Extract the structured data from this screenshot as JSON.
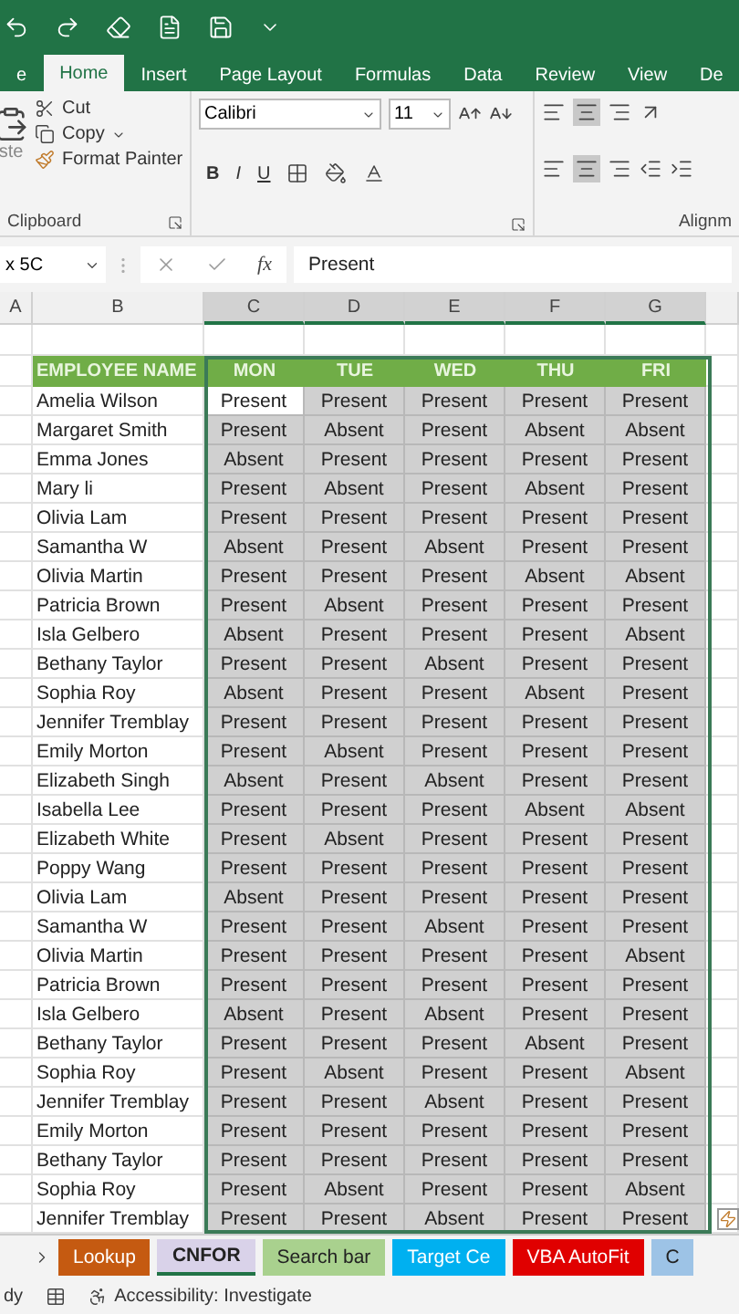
{
  "ribbon_tabs": [
    {
      "label": "e",
      "selected": false
    },
    {
      "label": "Home",
      "selected": true
    },
    {
      "label": "Insert",
      "selected": false
    },
    {
      "label": "Page Layout",
      "selected": false
    },
    {
      "label": "Formulas",
      "selected": false
    },
    {
      "label": "Data",
      "selected": false
    },
    {
      "label": "Review",
      "selected": false
    },
    {
      "label": "View",
      "selected": false
    },
    {
      "label": "De",
      "selected": false
    }
  ],
  "clipboard": {
    "paste": "ste",
    "cut": "Cut",
    "copy": "Copy",
    "format_painter": "Format Painter",
    "group_label": "Clipboard"
  },
  "font": {
    "name": "Calibri",
    "size": "11",
    "bold": "B",
    "italic": "I",
    "underline": "U"
  },
  "alignment": {
    "group_label": "Alignm"
  },
  "formula_bar": {
    "name_box": "x 5C",
    "fx": "fx",
    "value": "Present"
  },
  "column_headers": [
    {
      "label": "A",
      "selected": false
    },
    {
      "label": "B",
      "selected": false
    },
    {
      "label": "C",
      "selected": true
    },
    {
      "label": "D",
      "selected": true
    },
    {
      "label": "E",
      "selected": true
    },
    {
      "label": "F",
      "selected": true
    },
    {
      "label": "G",
      "selected": true
    }
  ],
  "table": {
    "columns": [
      "EMPLOYEE NAME",
      "MON",
      "TUE",
      "WED",
      "THU",
      "FRI"
    ],
    "rows": [
      {
        "active": true,
        "cells": [
          "Amelia Wilson",
          "Present",
          "Present",
          "Present",
          "Present",
          "Present"
        ]
      },
      {
        "active": false,
        "cells": [
          "Margaret Smith",
          "Present",
          "Absent",
          "Present",
          "Absent",
          "Absent"
        ]
      },
      {
        "active": false,
        "cells": [
          "Emma Jones",
          "Absent",
          "Present",
          "Present",
          "Present",
          "Present"
        ]
      },
      {
        "active": false,
        "cells": [
          "Mary li",
          "Present",
          "Absent",
          "Present",
          "Absent",
          "Present"
        ]
      },
      {
        "active": false,
        "cells": [
          "Olivia Lam",
          "Present",
          "Present",
          "Present",
          "Present",
          "Present"
        ]
      },
      {
        "active": false,
        "cells": [
          "Samantha W",
          "Absent",
          "Present",
          "Absent",
          "Present",
          "Present"
        ]
      },
      {
        "active": false,
        "cells": [
          "Olivia Martin",
          "Present",
          "Present",
          "Present",
          "Absent",
          "Absent"
        ]
      },
      {
        "active": false,
        "cells": [
          "Patricia Brown",
          "Present",
          "Absent",
          "Present",
          "Present",
          "Present"
        ]
      },
      {
        "active": false,
        "cells": [
          "Isla Gelbero",
          "Absent",
          "Present",
          "Present",
          "Present",
          "Absent"
        ]
      },
      {
        "active": false,
        "cells": [
          "Bethany Taylor",
          "Present",
          "Present",
          "Absent",
          "Present",
          "Present"
        ]
      },
      {
        "active": false,
        "cells": [
          "Sophia Roy",
          "Absent",
          "Present",
          "Present",
          "Absent",
          "Present"
        ]
      },
      {
        "active": false,
        "cells": [
          "Jennifer Tremblay",
          "Present",
          "Present",
          "Present",
          "Present",
          "Present"
        ]
      },
      {
        "active": false,
        "cells": [
          "Emily Morton",
          "Present",
          "Absent",
          "Present",
          "Present",
          "Present"
        ]
      },
      {
        "active": false,
        "cells": [
          "Elizabeth Singh",
          "Absent",
          "Present",
          "Absent",
          "Present",
          "Present"
        ]
      },
      {
        "active": false,
        "cells": [
          "Isabella Lee",
          "Present",
          "Present",
          "Present",
          "Absent",
          "Absent"
        ]
      },
      {
        "active": false,
        "cells": [
          "Elizabeth White",
          "Present",
          "Absent",
          "Present",
          "Present",
          "Present"
        ]
      },
      {
        "active": false,
        "cells": [
          "Poppy Wang",
          "Present",
          "Present",
          "Present",
          "Present",
          "Present"
        ]
      },
      {
        "active": false,
        "cells": [
          "Olivia Lam",
          "Absent",
          "Present",
          "Present",
          "Present",
          "Present"
        ]
      },
      {
        "active": false,
        "cells": [
          "Samantha W",
          "Present",
          "Present",
          "Absent",
          "Present",
          "Present"
        ]
      },
      {
        "active": false,
        "cells": [
          "Olivia Martin",
          "Present",
          "Present",
          "Present",
          "Present",
          "Absent"
        ]
      },
      {
        "active": false,
        "cells": [
          "Patricia Brown",
          "Present",
          "Present",
          "Present",
          "Present",
          "Present"
        ]
      },
      {
        "active": false,
        "cells": [
          "Isla Gelbero",
          "Absent",
          "Present",
          "Absent",
          "Present",
          "Present"
        ]
      },
      {
        "active": false,
        "cells": [
          "Bethany Taylor",
          "Present",
          "Present",
          "Present",
          "Absent",
          "Present"
        ]
      },
      {
        "active": false,
        "cells": [
          "Sophia Roy",
          "Present",
          "Absent",
          "Present",
          "Present",
          "Absent"
        ]
      },
      {
        "active": false,
        "cells": [
          "Jennifer Tremblay",
          "Present",
          "Present",
          "Absent",
          "Present",
          "Present"
        ]
      },
      {
        "active": false,
        "cells": [
          "Emily Morton",
          "Present",
          "Present",
          "Present",
          "Present",
          "Present"
        ]
      },
      {
        "active": false,
        "cells": [
          "Bethany Taylor",
          "Present",
          "Present",
          "Present",
          "Present",
          "Present"
        ]
      },
      {
        "active": false,
        "cells": [
          "Sophia Roy",
          "Present",
          "Absent",
          "Present",
          "Present",
          "Absent"
        ]
      },
      {
        "active": false,
        "cells": [
          "Jennifer Tremblay",
          "Present",
          "Present",
          "Absent",
          "Present",
          "Present"
        ]
      }
    ]
  },
  "sheet_tabs": [
    {
      "label": "Lookup",
      "color": "#c55a11",
      "selected": false
    },
    {
      "label": "CNFOR",
      "color": "#d9d2e9",
      "selected": true
    },
    {
      "label": "Search bar",
      "color": "#a9d18e",
      "selected": false
    },
    {
      "label": "Target Ce",
      "color": "#00b0f0",
      "selected": false
    },
    {
      "label": "VBA AutoFit",
      "color": "#e00000",
      "selected": false
    },
    {
      "label": "C",
      "color": "#9dc3e6",
      "selected": false
    }
  ],
  "status_bar": {
    "mode": "dy",
    "accessibility": "Accessibility: Investigate"
  }
}
